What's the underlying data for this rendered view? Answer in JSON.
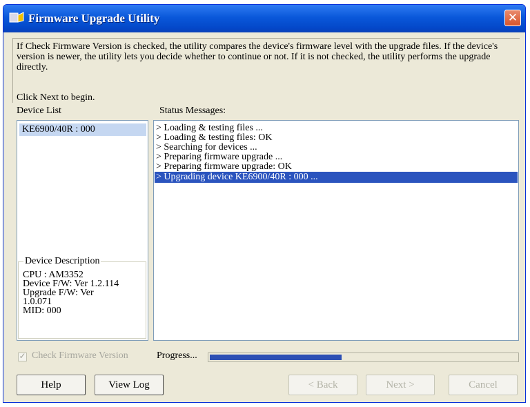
{
  "window": {
    "title": "Firmware Upgrade Utility"
  },
  "intro": {
    "text": "If Check Firmware Version is checked, the utility compares the device's firmware level with the upgrade files. If the device's version is newer, the utility lets you decide whether to continue or not. If it is not checked, the utility performs the upgrade directly.",
    "begin": "Click Next to begin."
  },
  "device_list": {
    "label": "Device List",
    "items": [
      "KE6900/40R : 000"
    ]
  },
  "device_description": {
    "legend": "Device Description",
    "lines": [
      "CPU : AM3352",
      "Device F/W: Ver 1.2.114",
      "Upgrade F/W: Ver",
      "1.0.071",
      "MID: 000"
    ]
  },
  "status": {
    "label": "Status Messages:",
    "messages": [
      "> Loading & testing files ...",
      "> Loading & testing files: OK",
      "> Searching for devices ...",
      "> Preparing firmware upgrade ...",
      "> Preparing firmware upgrade: OK",
      "> Upgrading device KE6900/40R : 000 ..."
    ]
  },
  "check_firmware": {
    "label": "Check Firmware Version",
    "checked": true,
    "enabled": false
  },
  "progress": {
    "label": "Progress...",
    "value_fraction": 0.43
  },
  "buttons": {
    "help": "Help",
    "view_log": "View Log",
    "back": "< Back",
    "next": "Next >",
    "cancel": "Cancel"
  },
  "colors": {
    "title_bar": "#0a58da",
    "selection": "#2b54be",
    "progress": "#2c4fb4"
  }
}
